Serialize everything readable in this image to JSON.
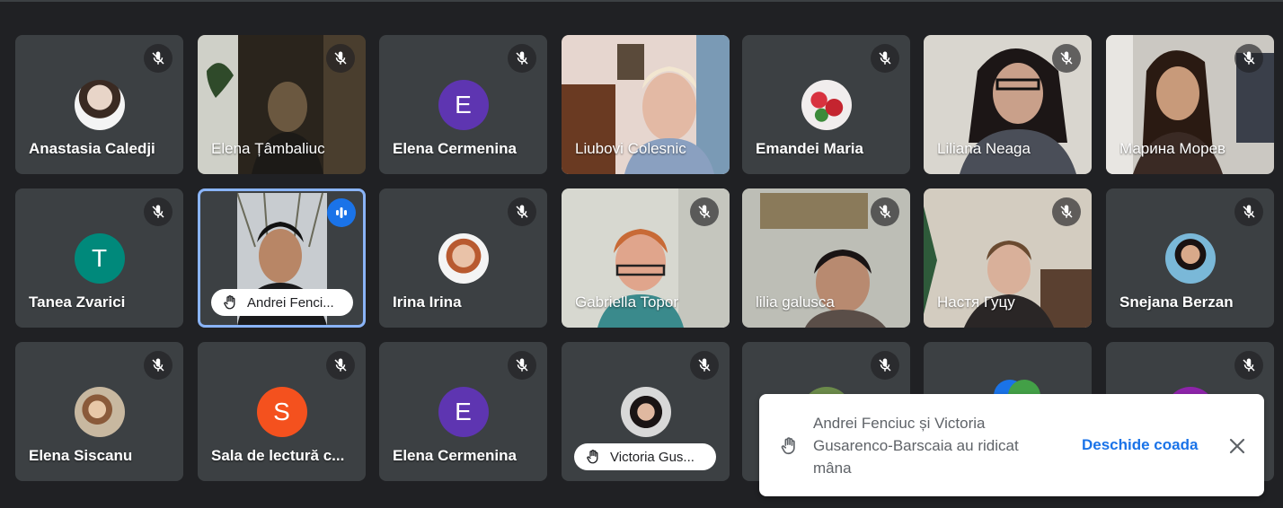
{
  "participants": [
    {
      "name": "Anastasia Caledji",
      "avatar_type": "photo"
    },
    {
      "name": "Elena Țâmbaliuc",
      "avatar_type": "video"
    },
    {
      "name": "Elena Cermenina",
      "avatar_type": "letter",
      "initial": "E",
      "color": "#5e35b1"
    },
    {
      "name": "Liubovi Colesnic",
      "avatar_type": "video"
    },
    {
      "name": "Emandei Maria",
      "avatar_type": "photo"
    },
    {
      "name": "Liliana Neaga",
      "avatar_type": "video"
    },
    {
      "name": "Марина Морев",
      "avatar_type": "video"
    },
    {
      "name": "Tanea Zvarici",
      "avatar_type": "letter",
      "initial": "T",
      "color": "#00897b"
    },
    {
      "name": "Andrei Fenci...",
      "avatar_type": "video",
      "hand_raised": true,
      "speaking": true
    },
    {
      "name": "Irina Irina",
      "avatar_type": "photo"
    },
    {
      "name": "Gabriella Topor",
      "avatar_type": "video"
    },
    {
      "name": "lilia galusca",
      "avatar_type": "video"
    },
    {
      "name": "Настя Гуцу",
      "avatar_type": "video"
    },
    {
      "name": "Snejana Berzan",
      "avatar_type": "photo"
    },
    {
      "name": "Elena Siscanu",
      "avatar_type": "photo"
    },
    {
      "name": "Sala de lectură c...",
      "avatar_type": "letter",
      "initial": "S",
      "color": "#f4511e"
    },
    {
      "name": "Elena Cermenina",
      "avatar_type": "letter",
      "initial": "E",
      "color": "#5e35b1"
    },
    {
      "name": "Victoria Gus...",
      "avatar_type": "photo",
      "hand_raised": true
    }
  ],
  "toast": {
    "message": "Andrei Fenciuc și Victoria Gusarenco-Barscaia au ridicat mâna",
    "action_label": "Deschide coada",
    "close_icon": "close-icon",
    "hand_icon": "hand-icon"
  },
  "colors": {
    "background": "#202124",
    "tile": "#3c4043",
    "accent": "#1a73e8",
    "active_border": "#8ab4f8"
  }
}
